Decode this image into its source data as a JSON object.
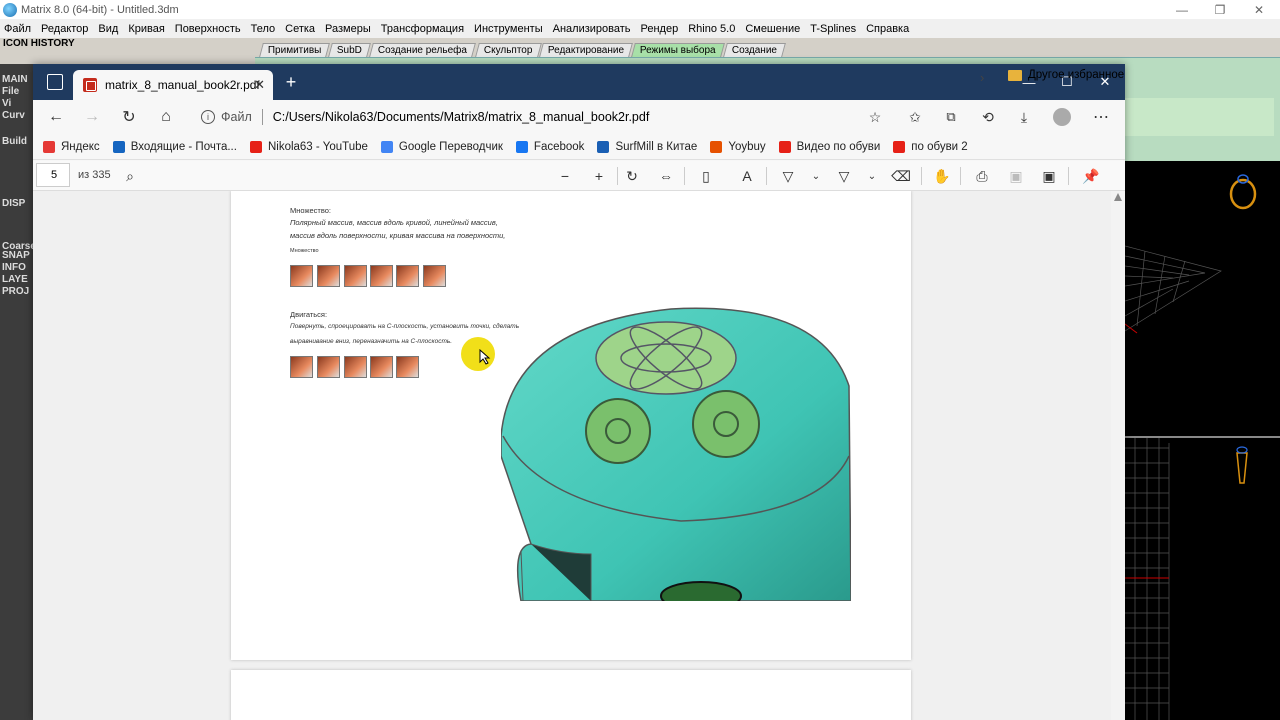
{
  "matrix": {
    "title": "Matrix 8.0 (64-bit) - Untitled.3dm",
    "menu": [
      "Файл",
      "Редактор",
      "Вид",
      "Кривая",
      "Поверхность",
      "Тело",
      "Сетка",
      "Размеры",
      "Трансформация",
      "Инструменты",
      "Анализировать",
      "Рендер",
      "Rhino 5.0",
      "Смешение",
      "T-Splines",
      "Справка"
    ],
    "icon_history": "ICON HISTORY",
    "tabs": [
      "Примитивы",
      "SubD",
      "Создание рельефа",
      "Скульптор",
      "Редактирование",
      "Режимы выбора",
      "Создание"
    ],
    "active_tab": "Режимы выбора",
    "left_labels": [
      "MAIN",
      "File",
      "Vi",
      "Curv",
      "Build",
      "DISP",
      "Coarse",
      "SNAP",
      "INFO",
      "LAYE",
      "PROJ"
    ]
  },
  "edge": {
    "tab_title": "matrix_8_manual_book2r.pdf",
    "file_scheme": "Файл",
    "url": "C:/Users/Nikola63/Documents/Matrix8/matrix_8_manual_book2r.pdf",
    "bookmarks": [
      {
        "label": "Яндекс",
        "color": "#e53935"
      },
      {
        "label": "Входящие - Почта...",
        "color": "#1565c0"
      },
      {
        "label": "Nikola63 - YouTube",
        "color": "#e62117"
      },
      {
        "label": "Google Переводчик",
        "color": "#4285f4"
      },
      {
        "label": "Facebook",
        "color": "#1877f2"
      },
      {
        "label": "SurfMill в Китае",
        "color": "#1a5fb4"
      },
      {
        "label": "Yoybuy",
        "color": "#e65100"
      },
      {
        "label": "Видео по обуви",
        "color": "#e62117"
      },
      {
        "label": "по обуви 2",
        "color": "#e62117"
      }
    ],
    "other_bookmarks": "Другое избранное",
    "pdf": {
      "page": "5",
      "of": "из 335"
    }
  },
  "document": {
    "s1_label": "Множество:",
    "s1_text1": "Полярный массив, массив вдоль кривой, линейный массив,",
    "s1_text2": "массив вдоль поверхности, кривая массива на поверхности,",
    "s1_small": "Множество",
    "s2_label": "Двигаться:",
    "s2_text1": "Повернуть, спроецировать на С-плоскость, установить точки, сделать",
    "s2_text2": "выравнивание вниз, переназначить на С-плоскость."
  }
}
